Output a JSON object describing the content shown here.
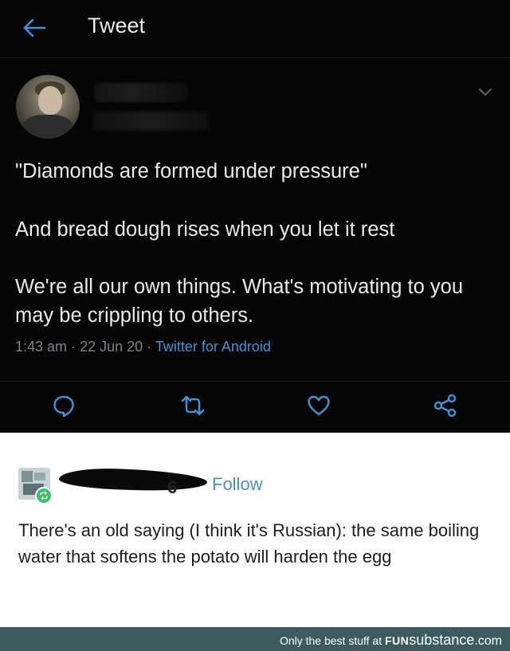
{
  "twitter": {
    "header": {
      "title": "Tweet",
      "back_icon": "arrow-left-icon"
    },
    "author": {
      "avatar_icon": "profile-photo",
      "name_obscured": true,
      "handle_obscured": true,
      "more_icon": "chevron-down-icon"
    },
    "tweet": {
      "line1": "\"Diamonds are formed under pressure\"",
      "line2": "And bread dough rises when you let it rest",
      "line3": "We're all our own things. What's motivating to you may be crippling to others.",
      "time": "1:43 am",
      "date": "22 Jun 20",
      "separator": "·",
      "source": "Twitter for Android"
    },
    "actions": {
      "reply_icon": "reply-bubble-icon",
      "retweet_icon": "retweet-icon",
      "like_icon": "heart-icon",
      "share_icon": "share-icon"
    },
    "colors": {
      "background": "#050505",
      "link": "#3f93d8",
      "muted": "#7b8289"
    }
  },
  "tumblr": {
    "user_tail": "6",
    "follow_label": "Follow",
    "reblog_icon": "reblog-icon",
    "body": "There's an old saying (I think it's Russian): the same boiling water that softens the potato will harden the egg",
    "colors": {
      "follow": "#4a8fc4",
      "reblog_badge": "#3bbf6b"
    }
  },
  "footer": {
    "tagline": "Only the best stuff at",
    "brand_fun": "FUN",
    "brand_substance": "substance",
    "brand_com": ".com",
    "background": "#3d5a5c"
  }
}
